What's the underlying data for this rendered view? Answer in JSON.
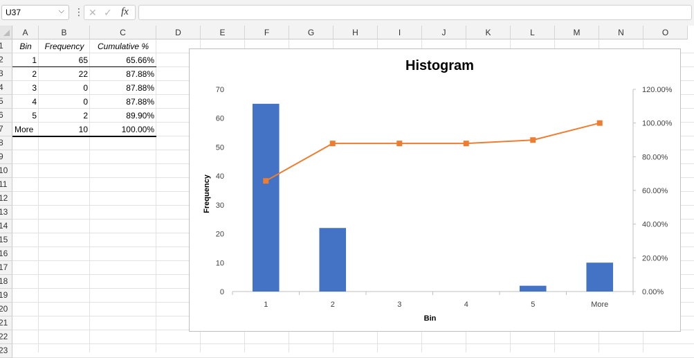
{
  "formula_bar": {
    "name_box": "U37",
    "name_box_dropdown_glyph": "⌵",
    "separator_glyph": "⋮",
    "cancel_glyph": "✕",
    "enter_glyph": "✓",
    "fx_label": "fx",
    "formula": ""
  },
  "sheet": {
    "columns": [
      "A",
      "B",
      "C",
      "D",
      "E",
      "F",
      "G",
      "H",
      "I",
      "J",
      "K",
      "L",
      "M",
      "N",
      "O"
    ],
    "rows": [
      "1",
      "2",
      "3",
      "4",
      "5",
      "6",
      "7",
      "8",
      "9",
      "10",
      "11",
      "12",
      "13",
      "14",
      "15",
      "16",
      "17",
      "18",
      "19",
      "20",
      "21",
      "22",
      "23"
    ],
    "table": {
      "headers": [
        "Bin",
        "Frequency",
        "Cumulative %"
      ],
      "rows": [
        [
          "1",
          "65",
          "65.66%"
        ],
        [
          "2",
          "22",
          "87.88%"
        ],
        [
          "3",
          "0",
          "87.88%"
        ],
        [
          "4",
          "0",
          "87.88%"
        ],
        [
          "5",
          "2",
          "89.90%"
        ],
        [
          "More",
          "10",
          "100.00%"
        ]
      ]
    }
  },
  "chart_data": {
    "type": "bar",
    "title": "Histogram",
    "xlabel": "Bin",
    "ylabel": "Frequency",
    "categories": [
      "1",
      "2",
      "3",
      "4",
      "5",
      "More"
    ],
    "series": [
      {
        "name": "Frequency",
        "type": "bar",
        "axis": "primary",
        "color": "#4472c4",
        "values": [
          65,
          22,
          0,
          0,
          2,
          10
        ]
      },
      {
        "name": "Cumulative %",
        "type": "line",
        "axis": "secondary",
        "color": "#ed7d31",
        "values": [
          65.66,
          87.88,
          87.88,
          87.88,
          89.9,
          100.0
        ]
      }
    ],
    "ylim": [
      0,
      70
    ],
    "yticks": [
      "0",
      "10",
      "20",
      "30",
      "40",
      "50",
      "60",
      "70"
    ],
    "y2lim": [
      0,
      120
    ],
    "y2ticks": [
      "0.00%",
      "20.00%",
      "40.00%",
      "60.00%",
      "80.00%",
      "100.00%",
      "120.00%"
    ],
    "grid": false,
    "legend": "none"
  }
}
